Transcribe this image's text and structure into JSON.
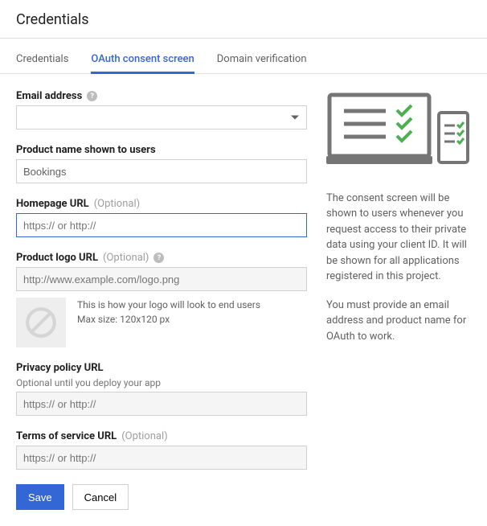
{
  "header": {
    "title": "Credentials"
  },
  "tabs": {
    "credentials": "Credentials",
    "oauth": "OAuth consent screen",
    "domain": "Domain verification"
  },
  "form": {
    "email_label": "Email address",
    "email_value": "",
    "product_name_label": "Product name shown to users",
    "product_name_value": "Bookings",
    "homepage_label": "Homepage URL",
    "homepage_placeholder": "https:// or http://",
    "homepage_value": "",
    "logo_url_label": "Product logo URL",
    "logo_url_placeholder": "http://www.example.com/logo.png",
    "logo_url_value": "",
    "logo_preview_line1": "This is how your logo will look to end users",
    "logo_preview_line2": "Max size: 120x120 px",
    "privacy_label": "Privacy policy URL",
    "privacy_sub": "Optional until you deploy your app",
    "privacy_placeholder": "https:// or http://",
    "tos_label": "Terms of service URL",
    "tos_placeholder": "https:// or http://",
    "optional_text": "(Optional)",
    "save": "Save",
    "cancel": "Cancel"
  },
  "side": {
    "p1": "The consent screen will be shown to users whenever you request access to their private data using your client ID. It will be shown for all applications registered in this project.",
    "p2": "You must provide an email address and product name for OAuth to work."
  }
}
